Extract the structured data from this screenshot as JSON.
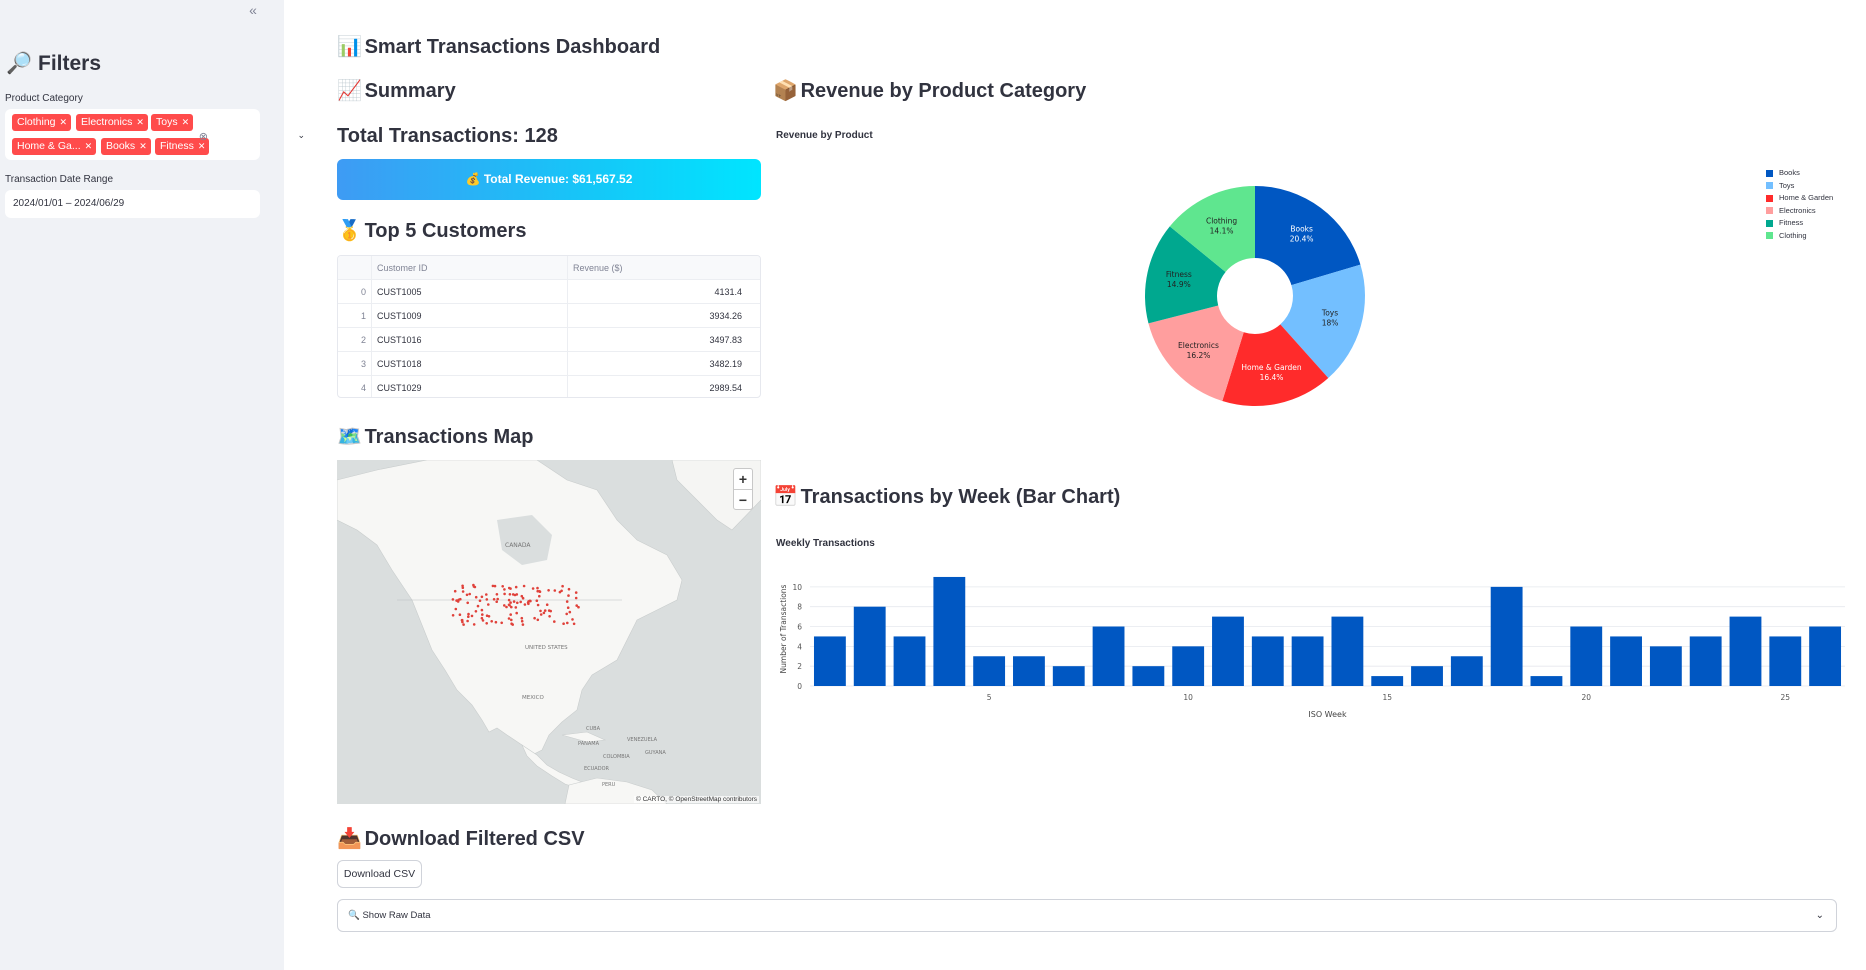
{
  "sidebar": {
    "collapse_icon": "«",
    "title": "Filters",
    "title_icon": "🔎",
    "category_label": "Product Category",
    "categories_selected": [
      {
        "label": "Clothing"
      },
      {
        "label": "Electronics"
      },
      {
        "label": "Toys"
      },
      {
        "label": "Home & Ga..."
      },
      {
        "label": "Books"
      },
      {
        "label": "Fitness"
      }
    ],
    "date_label": "Transaction Date Range",
    "date_value": "2024/01/01 – 2024/06/29"
  },
  "main": {
    "title": "Smart Transactions Dashboard",
    "title_icon": "📊",
    "summary": {
      "heading": "Summary",
      "icon": "📈",
      "total_transactions": "Total Transactions: 128",
      "total_revenue": "💰 Total Revenue: $61,567.52"
    },
    "top_customers": {
      "heading": "Top 5 Customers",
      "icon": "🥇",
      "columns": [
        "Customer ID",
        "Revenue ($)"
      ],
      "rows": [
        {
          "idx": "0",
          "id": "CUST1005",
          "revenue": "4131.4"
        },
        {
          "idx": "1",
          "id": "CUST1009",
          "revenue": "3934.26"
        },
        {
          "idx": "2",
          "id": "CUST1016",
          "revenue": "3497.83"
        },
        {
          "idx": "3",
          "id": "CUST1018",
          "revenue": "3482.19"
        },
        {
          "idx": "4",
          "id": "CUST1029",
          "revenue": "2989.54"
        }
      ]
    },
    "map": {
      "heading": "Transactions Map",
      "icon": "🗺️",
      "zoom_in": "+",
      "zoom_out": "−",
      "attribution": "© CARTO, © OpenStreetMap contributors",
      "labels": [
        "CANADA",
        "UNITED STATES",
        "MEXICO",
        "CUBA",
        "PANAMA",
        "VENEZUELA",
        "COLOMBIA",
        "GUYANA",
        "ECUADOR",
        "PERU"
      ],
      "point_color": "#e0413a"
    },
    "revenue_by_category": {
      "heading": "Revenue by Product Category",
      "icon": "📦"
    },
    "weekly": {
      "heading": "Transactions by Week (Bar Chart)",
      "icon": "📅"
    },
    "download": {
      "heading": "Download Filtered CSV",
      "icon": "📥",
      "button_label": "Download CSV",
      "expander_label": "🔍 Show Raw Data",
      "expander_chevron": "⌄"
    }
  },
  "chart_data": [
    {
      "type": "pie",
      "title": "Revenue by Product",
      "hole": true,
      "categories": [
        "Books",
        "Toys",
        "Home & Garden",
        "Electronics",
        "Fitness",
        "Clothing"
      ],
      "values": [
        20.4,
        18,
        16.4,
        16.2,
        14.9,
        14.1
      ],
      "slice_labels": [
        "20.4%",
        "18%",
        "16.4%",
        "16.2%",
        "14.9%",
        "14.1%"
      ],
      "colors": [
        "#0057c2",
        "#73bfff",
        "#ff2b2b",
        "#ff9e9e",
        "#00a88f",
        "#5fe68f"
      ],
      "legend": "top-right"
    },
    {
      "type": "bar",
      "title": "Weekly Transactions",
      "xlabel": "ISO Week",
      "ylabel": "Number of Transactions",
      "x": [
        1,
        2,
        3,
        4,
        5,
        6,
        7,
        8,
        9,
        10,
        11,
        12,
        13,
        14,
        15,
        16,
        17,
        18,
        19,
        20,
        21,
        22,
        23,
        24,
        25,
        26
      ],
      "values": [
        5,
        8,
        5,
        11,
        3,
        3,
        2,
        6,
        2,
        4,
        7,
        5,
        5,
        7,
        1,
        2,
        3,
        10,
        1,
        6,
        5,
        4,
        5,
        7,
        5,
        6
      ],
      "xticks": [
        5,
        10,
        15,
        20,
        25
      ],
      "yticks": [
        0,
        2,
        4,
        6,
        8,
        10
      ],
      "ylim": [
        0,
        11.5
      ],
      "color": "#0057c2",
      "grid": true
    }
  ]
}
